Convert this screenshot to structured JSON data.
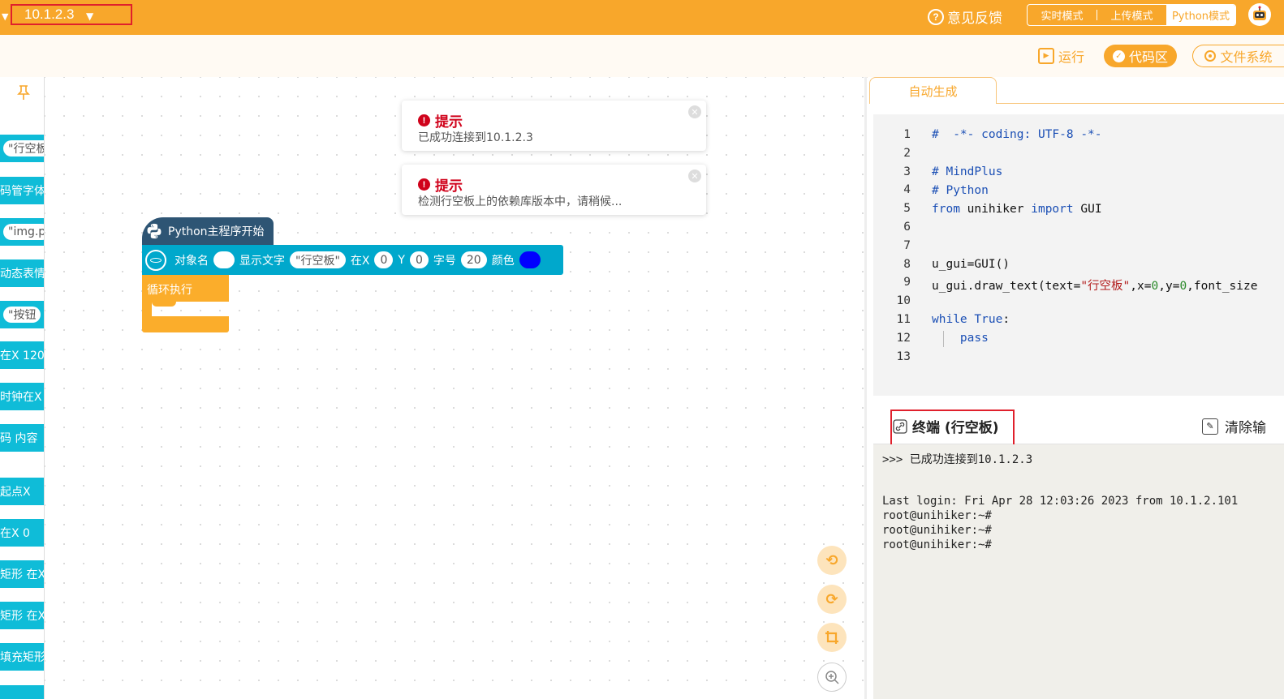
{
  "topbar": {
    "device": "10.1.2.3",
    "feedback": "意见反馈",
    "modes": [
      "实时模式",
      "上传模式",
      "Python模式"
    ],
    "active_mode": "Python模式"
  },
  "toolbar": {
    "run": "运行",
    "code_area": "代码区",
    "file_system": "文件系统"
  },
  "palette": {
    "blocks": [
      "\"行空板",
      "码管字体",
      "\"img.p",
      "动态表情",
      "\"按钮",
      "在X 120",
      "时钟在X",
      "码 内容",
      "起点X",
      "在X 0",
      "矩形 在X",
      "矩形 在X",
      "填充矩形"
    ]
  },
  "toasts": [
    {
      "title": "提示",
      "message": "已成功连接到10.1.2.3"
    },
    {
      "title": "提示",
      "message": "检测行空板上的依赖库版本中，请稍候..."
    }
  ],
  "blocks": {
    "main": "Python主程序开始",
    "obj_label": "对象名",
    "show_text": "显示文字",
    "text_value": "\"行空板\"",
    "at_x": "在X",
    "x_value": "0",
    "y_label": "Y",
    "y_value": "0",
    "font_label": "字号",
    "font_value": "20",
    "color_label": "颜色",
    "color_value": "#0000ff",
    "loop": "循环执行"
  },
  "code": {
    "tab": "自动生成",
    "line_numbers": [
      "1",
      "2",
      "3",
      "4",
      "5",
      "6",
      "7",
      "8",
      "9",
      "10",
      "11",
      "12",
      "13"
    ],
    "lines": [
      "#  -*- coding: UTF-8 -*-",
      "",
      "# MindPlus",
      "# Python",
      "from unihiker import GUI",
      "",
      "",
      "u_gui=GUI()",
      "u_gui.draw_text(text=\"行空板\",x=0,y=0,font_size",
      "",
      "while True:",
      "    pass",
      ""
    ]
  },
  "terminal": {
    "title": "终端 (行空板)",
    "clear": "清除输",
    "lines": [
      ">>> 已成功连接到10.1.2.3",
      "",
      "",
      "Last login: Fri Apr 28 12:03:26 2023 from 10.1.2.101",
      "root@unihiker:~#",
      "root@unihiker:~#",
      "root@unihiker:~#"
    ]
  },
  "colors": {
    "accent": "#f8a72b",
    "block_cyan": "#00a8cc",
    "block_navy": "#2e5574",
    "block_orange": "#fbad2b",
    "highlight_box": "#e0202c"
  }
}
